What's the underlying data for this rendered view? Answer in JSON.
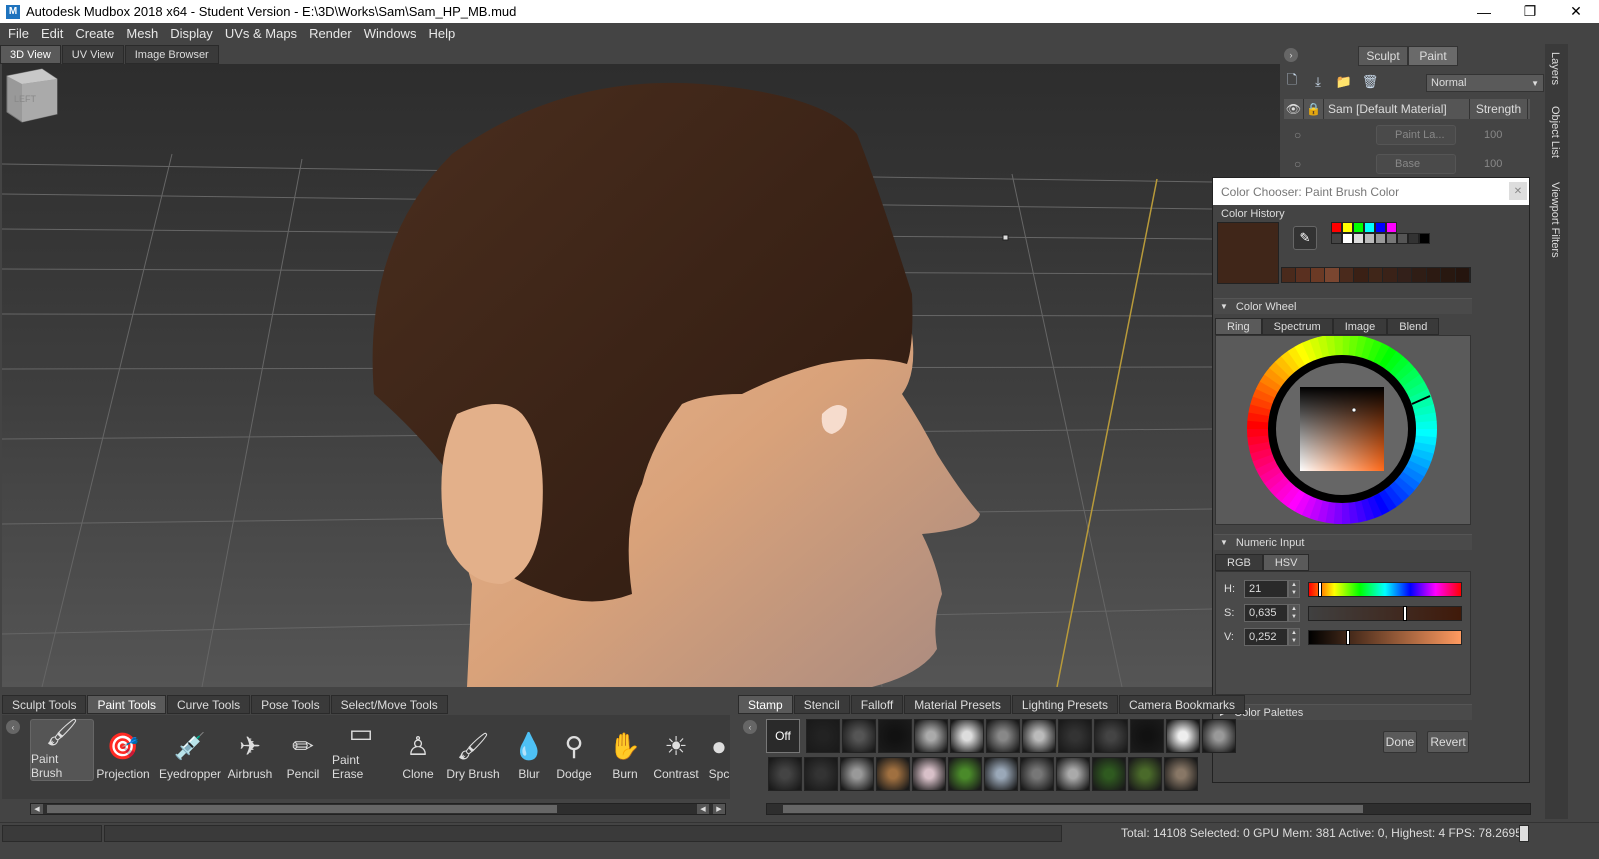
{
  "window": {
    "title": "Autodesk Mudbox 2018 x64 - Student Version - E:\\3D\\Works\\Sam\\Sam_HP_MB.mud",
    "app_icon_letter": "M",
    "minimize": "—",
    "restore": "❐",
    "close": "✕"
  },
  "menu": [
    "File",
    "Edit",
    "Create",
    "Mesh",
    "Display",
    "UVs & Maps",
    "Render",
    "Windows",
    "Help"
  ],
  "viewport_tabs": [
    "3D View",
    "UV View",
    "Image Browser"
  ],
  "viewcube_label": "LEFT",
  "right_panel": {
    "tabs": [
      "Sculpt",
      "Paint"
    ],
    "blend_mode": "Normal",
    "layers_header": {
      "material": "Sam [Default Material]",
      "strength": "Strength"
    },
    "layers": [
      {
        "name": "Paint La...",
        "strength": "100"
      },
      {
        "name": "Base",
        "strength": "100"
      }
    ]
  },
  "side_tabs": [
    "Layers",
    "Object List",
    "Viewport Filters"
  ],
  "color_chooser": {
    "title": "Color Chooser: Paint Brush Color",
    "close": "✕",
    "history_label": "Color History",
    "current_color": "#402619",
    "history_colors_row1": [
      "#ff0000",
      "#ffff00",
      "#00ff00",
      "#00ffff",
      "#0000ff",
      "#ff00ff"
    ],
    "history_colors_row2": [
      "#ffffff",
      "#dddddd",
      "#bbbbbb",
      "#999999",
      "#777777",
      "#555555",
      "#333333",
      "#000000"
    ],
    "recent_colors": [
      "#4a2a1c",
      "#5a3020",
      "#6b3a25",
      "#7a4630",
      "#4a2a1c",
      "#3a2015",
      "#402619",
      "#3a2218",
      "#33201a",
      "#2f1d15",
      "#2c1a12",
      "#281810",
      "#25150e"
    ],
    "color_wheel_label": "Color Wheel",
    "wheel_tabs": [
      "Ring",
      "Spectrum",
      "Image",
      "Blend"
    ],
    "numeric_input_label": "Numeric Input",
    "numeric_tabs": [
      "RGB",
      "HSV"
    ],
    "hsv": [
      {
        "label": "H:",
        "value": "21",
        "level": 0.058
      },
      {
        "label": "S:",
        "value": "0,635",
        "level": 0.635
      },
      {
        "label": "V:",
        "value": "0,252",
        "level": 0.252
      }
    ],
    "color_palettes_label": "Color Palettes",
    "done": "Done",
    "revert": "Revert"
  },
  "tray_tabs_left": [
    "Sculpt Tools",
    "Paint Tools",
    "Curve Tools",
    "Pose Tools",
    "Select/Move Tools"
  ],
  "tray_tabs_right": [
    "Stamp",
    "Stencil",
    "Falloff",
    "Material Presets",
    "Lighting Presets",
    "Camera Bookmarks"
  ],
  "paint_tools": [
    {
      "label": "Paint Brush",
      "icon": "paint-brush-icon",
      "glyph": "🖌"
    },
    {
      "label": "Projection",
      "icon": "projection-icon",
      "glyph": "🎯"
    },
    {
      "label": "Eyedropper",
      "icon": "eyedropper-icon",
      "glyph": "💉"
    },
    {
      "label": "Airbrush",
      "icon": "airbrush-icon",
      "glyph": "✈"
    },
    {
      "label": "Pencil",
      "icon": "pencil-icon",
      "glyph": "✏"
    },
    {
      "label": "Paint Erase",
      "icon": "eraser-icon",
      "glyph": "▭"
    },
    {
      "label": "Clone",
      "icon": "clone-icon",
      "glyph": "♙"
    },
    {
      "label": "Dry Brush",
      "icon": "dry-brush-icon",
      "glyph": "🖌"
    },
    {
      "label": "Blur",
      "icon": "blur-icon",
      "glyph": "💧"
    },
    {
      "label": "Dodge",
      "icon": "dodge-icon",
      "glyph": "⚲"
    },
    {
      "label": "Burn",
      "icon": "burn-icon",
      "glyph": "✋"
    },
    {
      "label": "Contrast",
      "icon": "contrast-icon",
      "glyph": "☀"
    },
    {
      "label": "Spc",
      "icon": "sponge-icon",
      "glyph": "●"
    }
  ],
  "stamp_off_label": "Off",
  "status": "Total: 14108  Selected: 0 GPU Mem: 381  Active: 0, Highest: 4  FPS: 78.2695"
}
